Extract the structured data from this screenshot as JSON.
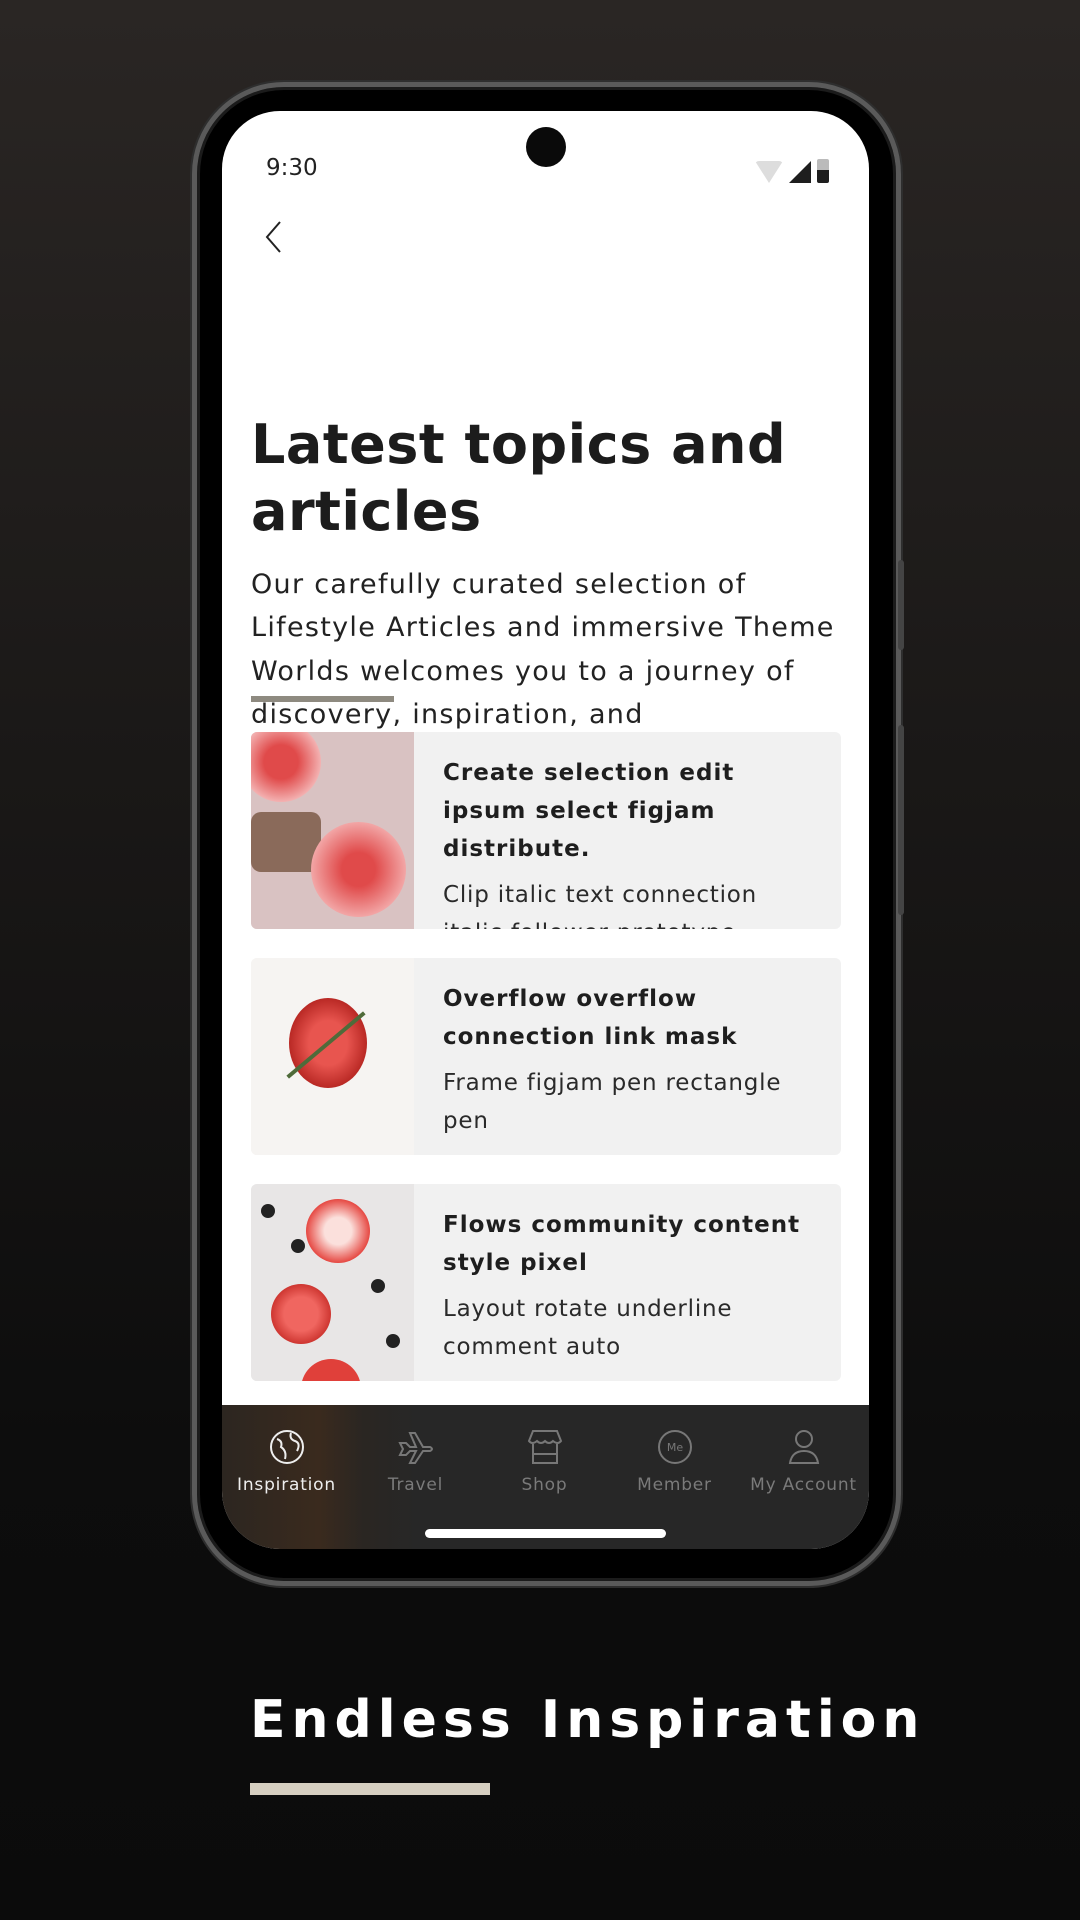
{
  "status_bar": {
    "time": "9:30",
    "icons": [
      "wifi-icon",
      "signal-icon",
      "battery-icon"
    ]
  },
  "header": {
    "back_icon": "chevron-left-icon"
  },
  "page": {
    "title": "Latest topics and articles",
    "intro": "Our carefully curated selection of Lifestyle Articles and immersive Theme Worlds welcomes you to a journey of discovery, inspiration, and transformation."
  },
  "articles": [
    {
      "title": "Create selection edit ipsum select figjam distribute.",
      "description": "Clip italic text connection italic follower prototype."
    },
    {
      "title": "Overflow overflow connection link mask",
      "description": "Frame figjam pen rectangle pen"
    },
    {
      "title": "Flows community content style pixel",
      "description": "Layout rotate underline comment auto"
    }
  ],
  "nav": {
    "items": [
      {
        "label": "Inspiration",
        "icon": "globe-icon",
        "active": true
      },
      {
        "label": "Travel",
        "icon": "airplane-icon",
        "active": false
      },
      {
        "label": "Shop",
        "icon": "shop-icon",
        "active": false
      },
      {
        "label": "Member",
        "icon": "member-icon",
        "active": false,
        "badge_text": "Me"
      },
      {
        "label": "My Account",
        "icon": "user-icon",
        "active": false
      }
    ]
  },
  "footer": {
    "tagline": "Endless Inspiration",
    "accent": "#d6cfc1"
  }
}
